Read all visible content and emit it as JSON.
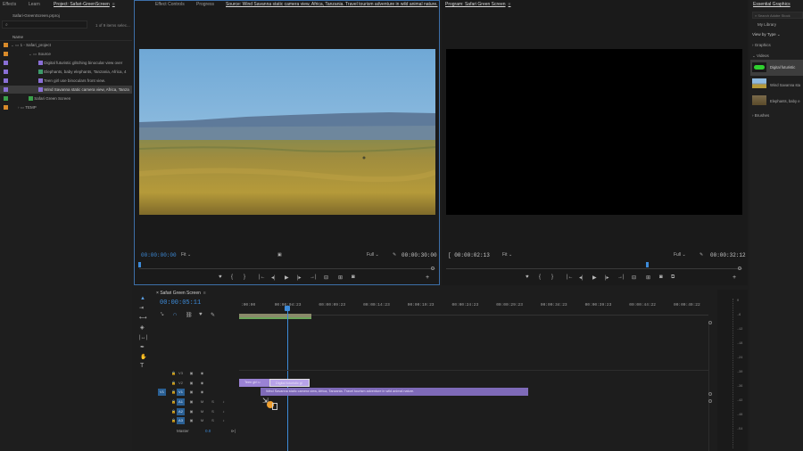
{
  "left_tabs": {
    "effects": "Effects",
    "learn": "Learn",
    "project": "Project: Safari-GreenScreen"
  },
  "project": {
    "file": "Safari-GreenScreen.prproj",
    "search_placeholder": "",
    "count": "1 of 9 items selec...",
    "col_name": "Name",
    "items": [
      {
        "label": "1 - Safari_project",
        "color": "#d98b2a"
      },
      {
        "label": "Source",
        "color": "#d98b2a"
      },
      {
        "label": "Digital futuristic glitching binocular view over",
        "color": "#8a6fd6"
      },
      {
        "label": "Elephants, baby elephants, Tanzania, Africa, 4",
        "color": "#8a6fd6"
      },
      {
        "label": "Teen girl use binoculars front view.",
        "color": "#8a6fd6"
      },
      {
        "label": "Wind Savanna static camera view, Africa, Tanza",
        "color": "#8a6fd6"
      },
      {
        "label": "Safari Green Screen",
        "color": "#3aa04a"
      },
      {
        "label": "TEMP",
        "color": "#d98b2a"
      }
    ]
  },
  "source": {
    "tabs": {
      "effect_controls": "Effect Controls",
      "progress": "Progress",
      "source": "Source: Wind Savanna static camera view, Africa, Tanzania. Travel tourism adventure in wild animal nature."
    },
    "timecode": "00:00:00:00",
    "fit": "Fit",
    "full": "Full",
    "duration": "00:00:30:00"
  },
  "program": {
    "tab": "Program: Safari Green Screen",
    "timecode": "00:00:02:13",
    "fit": "Fit",
    "full": "Full",
    "duration": "00:00:32:12"
  },
  "timeline": {
    "tab": "Safari Green Screen",
    "timecode": "00:00:05:11",
    "ruler": [
      ":00:00",
      "00:00:04:23",
      "00:00:09:23",
      "00:00:14:23",
      "00:00:19:23",
      "00:00:24:23",
      "00:00:29:23",
      "00:00:34:23",
      "00:00:39:23",
      "00:00:44:22",
      "00:00:49:22"
    ],
    "video_tracks": [
      "V3",
      "V2",
      "V1"
    ],
    "audio_tracks": [
      "A1",
      "A2",
      "A3"
    ],
    "master_label": "Master",
    "master_value": "0.0",
    "clips": {
      "v2a": "Teen girl u",
      "v2b": "Digital futuristic gl",
      "v1": "Wind Savanna static camera view, Africa, Tanzania. Travel tourism adventure in wild animal nature."
    }
  },
  "eg": {
    "title": "Essential Graphics",
    "search_placeholder": "Search Adobe Stock",
    "library": "My Library",
    "view_by": "View by Type",
    "graphics": "Graphics",
    "videos": "Videos",
    "items": [
      "Digital futuristic",
      "Wind Savanna sta",
      "Elephants, baby e"
    ],
    "brushes": "Brushes"
  },
  "meter": [
    "0",
    "-6",
    "-12",
    "-18",
    "-24",
    "-30",
    "-36",
    "-42",
    "-48",
    "-54"
  ]
}
